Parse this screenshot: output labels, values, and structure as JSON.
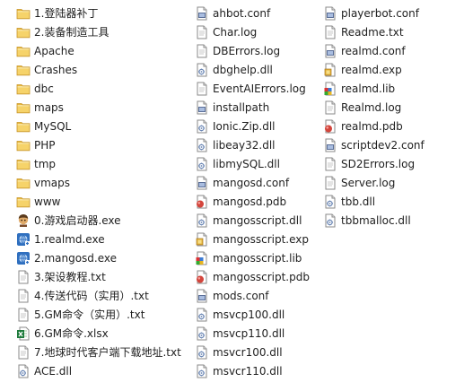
{
  "columns": [
    [
      {
        "label": "1.登陆器补丁",
        "icon": "folder-icon"
      },
      {
        "label": "2.装备制造工具",
        "icon": "folder-icon"
      },
      {
        "label": "Apache",
        "icon": "folder-icon"
      },
      {
        "label": "Crashes",
        "icon": "folder-icon"
      },
      {
        "label": "dbc",
        "icon": "folder-icon"
      },
      {
        "label": "maps",
        "icon": "folder-icon"
      },
      {
        "label": "MySQL",
        "icon": "folder-icon"
      },
      {
        "label": "PHP",
        "icon": "folder-icon"
      },
      {
        "label": "tmp",
        "icon": "folder-icon"
      },
      {
        "label": "vmaps",
        "icon": "folder-icon"
      },
      {
        "label": "www",
        "icon": "folder-icon"
      },
      {
        "label": "0.游戏启动器.exe",
        "icon": "launcher-exe-icon"
      },
      {
        "label": "1.realmd.exe",
        "icon": "server-exe-icon"
      },
      {
        "label": "2.mangosd.exe",
        "icon": "server-exe-icon"
      },
      {
        "label": "3.架设教程.txt",
        "icon": "text-file-icon"
      },
      {
        "label": "4.传送代码（实用）.txt",
        "icon": "text-file-icon"
      },
      {
        "label": "5.GM命令（实用）.txt",
        "icon": "text-file-icon"
      },
      {
        "label": "6.GM命令.xlsx",
        "icon": "excel-file-icon"
      },
      {
        "label": "7.地球时代客户端下载地址.txt",
        "icon": "text-file-icon"
      },
      {
        "label": "ACE.dll",
        "icon": "dll-file-icon"
      }
    ],
    [
      {
        "label": "ahbot.conf",
        "icon": "conf-file-icon"
      },
      {
        "label": "Char.log",
        "icon": "text-file-icon"
      },
      {
        "label": "DBErrors.log",
        "icon": "text-file-icon"
      },
      {
        "label": "dbghelp.dll",
        "icon": "dll-file-icon"
      },
      {
        "label": "EventAIErrors.log",
        "icon": "text-file-icon"
      },
      {
        "label": "installpath",
        "icon": "conf-file-icon"
      },
      {
        "label": "Ionic.Zip.dll",
        "icon": "dll-file-icon"
      },
      {
        "label": "libeay32.dll",
        "icon": "dll-file-icon"
      },
      {
        "label": "libmySQL.dll",
        "icon": "dll-file-icon"
      },
      {
        "label": "mangosd.conf",
        "icon": "conf-file-icon"
      },
      {
        "label": "mangosd.pdb",
        "icon": "pdb-file-icon"
      },
      {
        "label": "mangosscript.dll",
        "icon": "dll-file-icon"
      },
      {
        "label": "mangosscript.exp",
        "icon": "exp-file-icon"
      },
      {
        "label": "mangosscript.lib",
        "icon": "lib-file-icon"
      },
      {
        "label": "mangosscript.pdb",
        "icon": "pdb-file-icon"
      },
      {
        "label": "mods.conf",
        "icon": "conf-file-icon"
      },
      {
        "label": "msvcp100.dll",
        "icon": "dll-file-icon"
      },
      {
        "label": "msvcp110.dll",
        "icon": "dll-file-icon"
      },
      {
        "label": "msvcr100.dll",
        "icon": "dll-file-icon"
      },
      {
        "label": "msvcr110.dll",
        "icon": "dll-file-icon"
      }
    ],
    [
      {
        "label": "playerbot.conf",
        "icon": "conf-file-icon"
      },
      {
        "label": "Readme.txt",
        "icon": "text-file-icon"
      },
      {
        "label": "realmd.conf",
        "icon": "conf-file-icon"
      },
      {
        "label": "realmd.exp",
        "icon": "exp-file-icon"
      },
      {
        "label": "realmd.lib",
        "icon": "lib-file-icon"
      },
      {
        "label": "Realmd.log",
        "icon": "text-file-icon"
      },
      {
        "label": "realmd.pdb",
        "icon": "pdb-file-icon"
      },
      {
        "label": "scriptdev2.conf",
        "icon": "conf-file-icon"
      },
      {
        "label": "SD2Errors.log",
        "icon": "text-file-icon"
      },
      {
        "label": "Server.log",
        "icon": "text-file-icon"
      },
      {
        "label": "tbb.dll",
        "icon": "dll-file-icon"
      },
      {
        "label": "tbbmalloc.dll",
        "icon": "dll-file-icon"
      }
    ]
  ]
}
